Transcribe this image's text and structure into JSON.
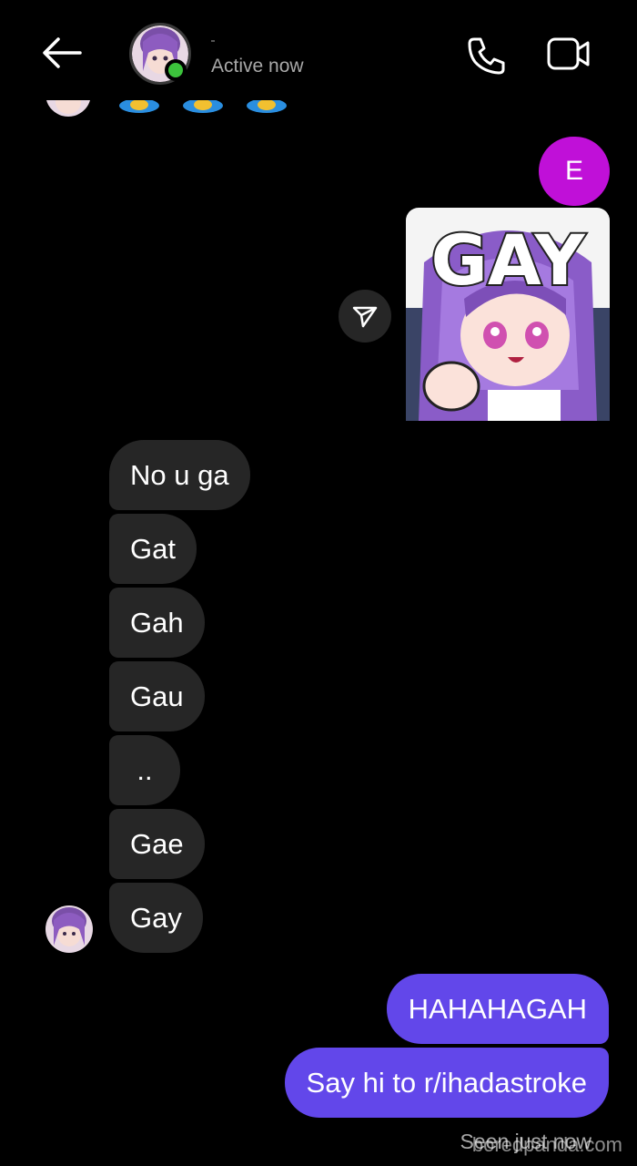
{
  "header": {
    "status": "Active now",
    "online_color": "#3cc33c",
    "icons": [
      "back-arrow-icon",
      "phone-icon",
      "video-camera-icon"
    ]
  },
  "messages": {
    "outgoing_initial": "E",
    "sticker_text": "GAY",
    "incoming": [
      "No u ga",
      "Gat",
      "Gah",
      "Gau",
      "..",
      "Gae",
      "Gay"
    ],
    "outgoing": [
      "HAHAHAGAH",
      "Say hi to r/ihadastroke"
    ]
  },
  "footer": {
    "seen": "Seen just now",
    "watermark": "boredpanda.com"
  },
  "colors": {
    "background": "#000000",
    "incoming_bubble": "#262626",
    "outgoing_bubble": "#6247ea",
    "initial_bubble": "#c010d8"
  }
}
